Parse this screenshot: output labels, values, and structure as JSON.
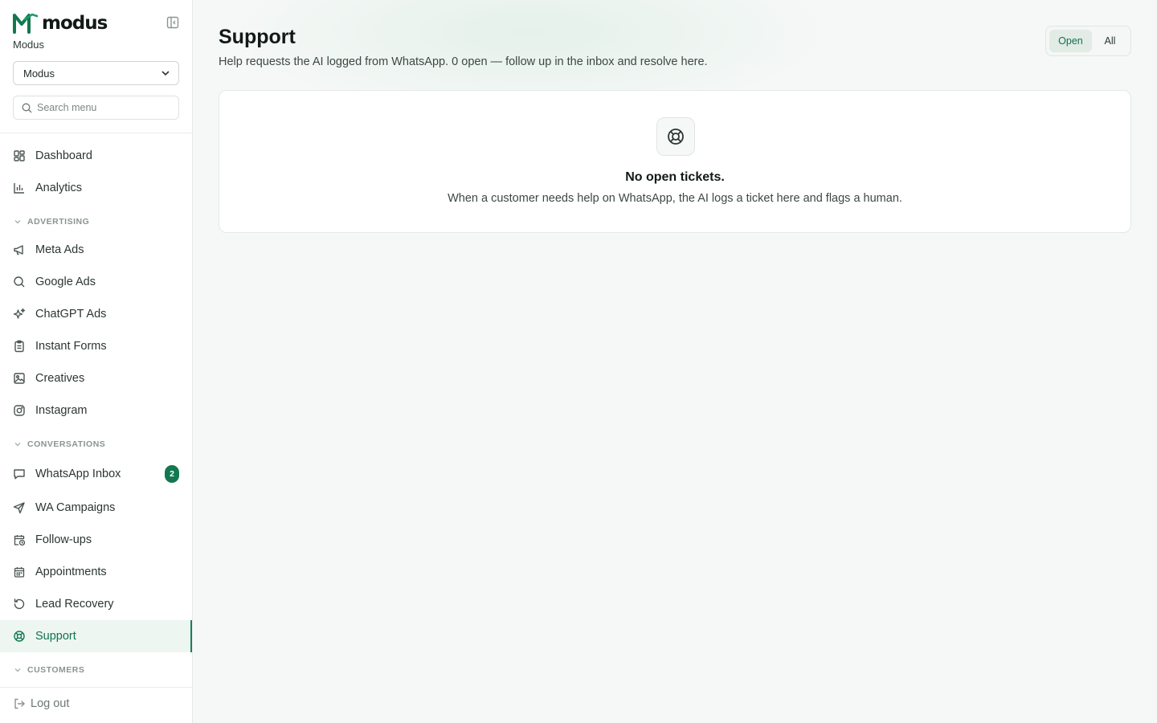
{
  "brand": {
    "name": "modus",
    "org_label": "Modus"
  },
  "org_select": {
    "value": "Modus"
  },
  "search": {
    "placeholder": "Search menu"
  },
  "nav": {
    "dashboard": "Dashboard",
    "analytics": "Analytics",
    "section_advertising": "ADVERTISING",
    "meta_ads": "Meta Ads",
    "google_ads": "Google Ads",
    "chatgpt_ads": "ChatGPT Ads",
    "instant_forms": "Instant Forms",
    "creatives": "Creatives",
    "instagram": "Instagram",
    "section_conversations": "CONVERSATIONS",
    "whatsapp_inbox": "WhatsApp Inbox",
    "whatsapp_inbox_badge": "2",
    "wa_campaigns": "WA Campaigns",
    "follow_ups": "Follow-ups",
    "appointments": "Appointments",
    "lead_recovery": "Lead Recovery",
    "support": "Support",
    "section_customers": "CUSTOMERS",
    "logout": "Log out"
  },
  "page": {
    "title": "Support",
    "subtitle": "Help requests the AI logged from WhatsApp. 0 open — follow up in the inbox and resolve here.",
    "filter_open": "Open",
    "filter_all": "All",
    "empty_title": "No open tickets.",
    "empty_desc": "When a customer needs help on WhatsApp, the AI logs a ticket here and flags a human."
  },
  "colors": {
    "accent": "#13774f",
    "active_bg": "#edf6f1"
  }
}
